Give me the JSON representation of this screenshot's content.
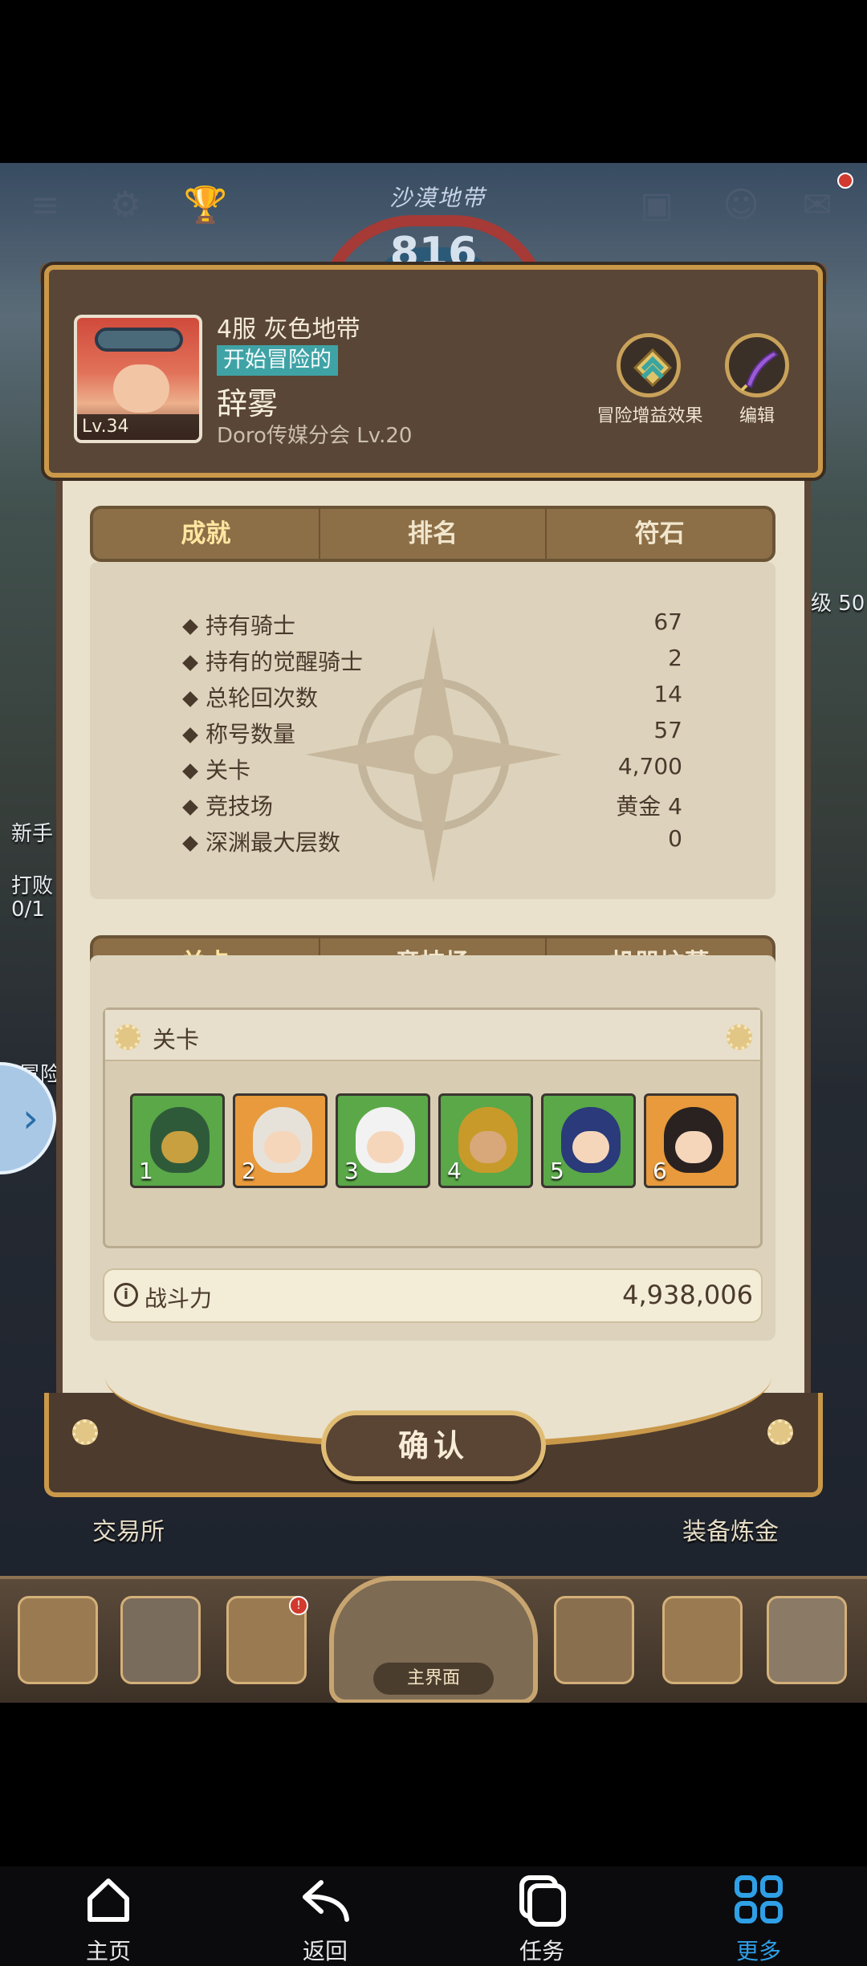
{
  "game": {
    "zone_name": "沙漠地带",
    "zone_number": "816",
    "left_side_labels": [
      "新手",
      "打败",
      "0/1",
      "冒险"
    ],
    "right_side_labels": [
      "级 50"
    ],
    "exchange_label": "交易所",
    "equip_label": "装备炼金",
    "main_label": "主界面"
  },
  "profile": {
    "server_line": "4服 灰色地带",
    "title_badge": "开始冒险的",
    "player_name": "辞雾",
    "avatar_level": "Lv.34",
    "guild": "Doro传媒分会 Lv.20",
    "buff_label": "冒险增益效果",
    "edit_label": "编辑"
  },
  "stats_tabs": [
    "成就",
    "排名",
    "符石"
  ],
  "stats": [
    {
      "label": "持有骑士",
      "value": "67"
    },
    {
      "label": "持有的觉醒骑士",
      "value": "2"
    },
    {
      "label": "总轮回次数",
      "value": "14"
    },
    {
      "label": "称号数量",
      "value": "57"
    },
    {
      "label": "关卡",
      "value": "4,700"
    },
    {
      "label": "竞技场",
      "value": "黄金 4"
    },
    {
      "label": "深渊最大层数",
      "value": "0"
    }
  ],
  "team_tabs": [
    "关卡",
    "竞技场",
    "机器坟墓"
  ],
  "team": {
    "header": "关卡",
    "slots": [
      "1",
      "2",
      "3",
      "4",
      "5",
      "6"
    ],
    "power_label": "战斗力",
    "power_value": "4,938,006"
  },
  "confirm_label": "确认",
  "system_nav": [
    "主页",
    "返回",
    "任务",
    "更多"
  ],
  "colors": {
    "accent": "#c99849",
    "panel": "#e9e1cc",
    "nav_active": "#2f9fe6"
  }
}
